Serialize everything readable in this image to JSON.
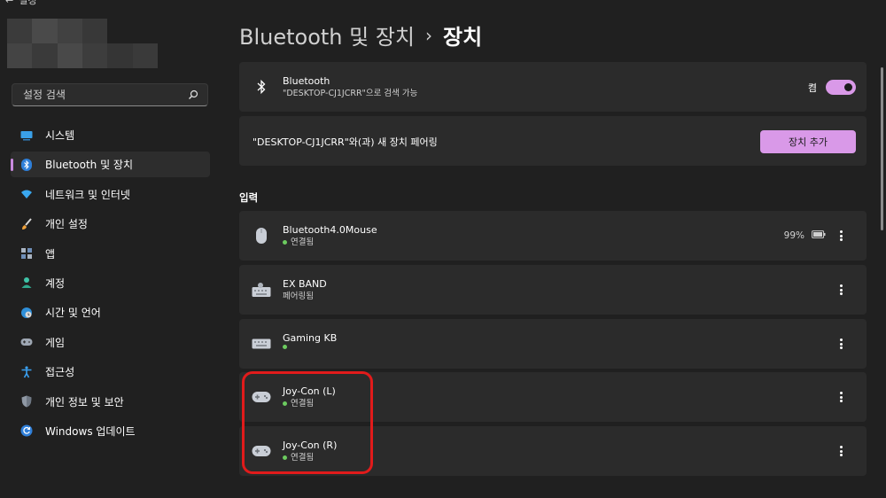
{
  "window": {
    "back_glyph": "←",
    "title": "설정"
  },
  "sidebar": {
    "search": {
      "placeholder": "설정 검색"
    },
    "items": [
      {
        "label": "시스템",
        "icon": "monitor-icon"
      },
      {
        "label": "Bluetooth 및 장치",
        "icon": "bluetooth-icon",
        "active": true
      },
      {
        "label": "네트워크 및 인터넷",
        "icon": "wifi-icon"
      },
      {
        "label": "개인 설정",
        "icon": "brush-icon"
      },
      {
        "label": "앱",
        "icon": "apps-icon"
      },
      {
        "label": "계정",
        "icon": "person-icon"
      },
      {
        "label": "시간 및 언어",
        "icon": "globe-clock-icon"
      },
      {
        "label": "게임",
        "icon": "gamepad-icon"
      },
      {
        "label": "접근성",
        "icon": "accessibility-icon"
      },
      {
        "label": "개인 정보 및 보안",
        "icon": "shield-icon"
      },
      {
        "label": "Windows 업데이트",
        "icon": "update-icon"
      }
    ]
  },
  "header": {
    "parent": "Bluetooth 및 장치",
    "separator": "›",
    "current": "장치"
  },
  "bluetooth": {
    "title": "Bluetooth",
    "subtitle": "\"DESKTOP-CJ1JCRR\"으로 검색 가능",
    "toggle_label": "켬",
    "toggle_on": true
  },
  "pairing": {
    "text": "\"DESKTOP-CJ1JCRR\"와(과) 새 장치 페어링",
    "button": "장치 추가"
  },
  "input_section": {
    "label": "입력"
  },
  "devices": [
    {
      "name": "Bluetooth4.0Mouse",
      "status": "연결됨",
      "connected": true,
      "battery": "99%",
      "icon": "mouse-icon"
    },
    {
      "name": "EX BAND",
      "status": "페어링됨",
      "connected": false,
      "icon": "keyboard-icon"
    },
    {
      "name": "Gaming KB",
      "status": "",
      "connected": true,
      "icon": "keyboard-icon"
    },
    {
      "name": "Joy-Con (L)",
      "status": "연결됨",
      "connected": true,
      "icon": "gamepad-icon"
    },
    {
      "name": "Joy-Con (R)",
      "status": "연결됨",
      "connected": true,
      "icon": "gamepad-icon"
    }
  ],
  "colors": {
    "accent": "#d999e8",
    "background": "#202020",
    "card": "#2b2b2b",
    "status_connected": "#6ccb5f",
    "highlight": "#e11b1b"
  }
}
